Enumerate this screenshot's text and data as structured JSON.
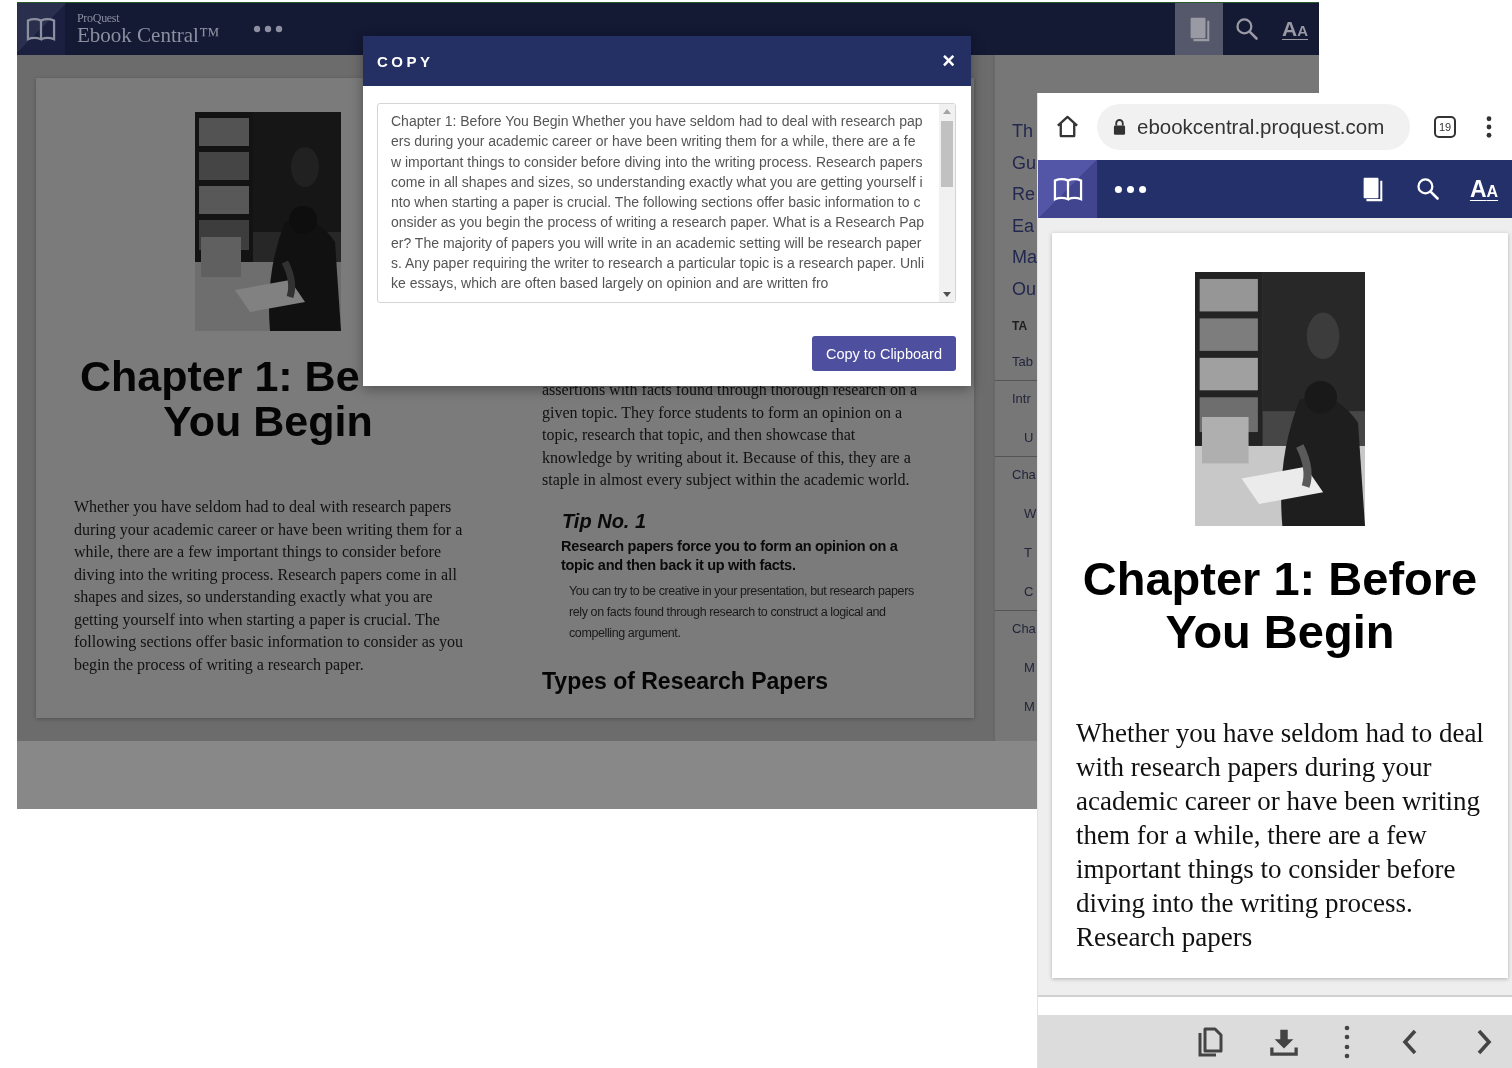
{
  "desktop": {
    "header": {
      "brand_small": "ProQuest",
      "brand": "Ebook Central™"
    },
    "toolbar": [
      {
        "kind": "book",
        "selected": true
      },
      {
        "kind": "search",
        "selected": false
      },
      {
        "kind": "text-size",
        "label": "AA",
        "selected": false
      }
    ],
    "page": {
      "title_lines": [
        "Chapter 1: Be",
        "You Begin"
      ],
      "paragraph": "Whether you have seldom had to deal with research papers during your academic career or have been writing them for a while, there are a few important things to consider before diving into the writing process. Research papers come in all shapes and sizes, so understanding exactly what you are getting yourself into when starting a paper is crucial. The following sections offer basic information to consider as you begin the process of writing a research paper.",
      "right_paragraph": "assertions with facts found through thorough research on a given topic. They force students to form an opinion on a topic, research that topic, and then showcase that knowledge by writing about it. Because of this, they are a staple in almost every subject within the academic world.",
      "tip_label": "Tip No. 1",
      "tip_heading": "Research papers force you to form an opinion on a topic and then back it up with facts.",
      "tip_text": "You can try to be creative in your presentation, but research papers rely on facts found through research to construct a logical and compelling argument.",
      "section_heading": "Types of Research Papers"
    },
    "sidebar": {
      "title_fragments": [
        "Th",
        "Gu",
        "Re",
        "Ea",
        "Ma",
        "Ou"
      ],
      "heading": "TA",
      "items": [
        {
          "label": "Tab"
        },
        {
          "label": "Intr",
          "children": [
            {
              "label": "U"
            }
          ]
        },
        {
          "label": "Cha",
          "children": [
            {
              "label": "W"
            },
            {
              "label": "T"
            },
            {
              "label": "C"
            }
          ]
        },
        {
          "label": "Cha",
          "children": [
            {
              "label": "M"
            },
            {
              "label": "M"
            }
          ]
        }
      ]
    }
  },
  "copy_dialog": {
    "title": "COPY",
    "close": "×",
    "text": "Chapter 1: Before You Begin Whether you have seldom had to deal with research papers during your academic career or have been writing them for a while, there are a few important things to consider before diving into the writing process. Research papers come in all shapes and sizes, so understanding exactly what you are getting yourself into when starting a paper is crucial. The following sections offer basic information to consider as you begin the process of writing a research paper. What is a Research Paper? The majority of papers you will write in an academic setting will be research papers. Any paper requiring the writer to research a particular topic is a research paper. Unlike essays, which are often based largely on opinion and are written fro",
    "button": "Copy to Clipboard"
  },
  "mobile": {
    "url": "ebookcentral.proquest.com",
    "tab_count": "19",
    "toolbar": [
      {
        "kind": "book",
        "selected": false
      },
      {
        "kind": "search",
        "selected": false
      },
      {
        "kind": "text-size",
        "label": "AA",
        "selected": false
      }
    ],
    "page": {
      "title_lines": [
        "Chapter 1: Before",
        "You Begin"
      ],
      "paragraph": "Whether you have seldom had to deal with research papers during your academic career or have been writing them for a while, there are a few important things to consider before diving into the writing process. Research papers"
    }
  }
}
